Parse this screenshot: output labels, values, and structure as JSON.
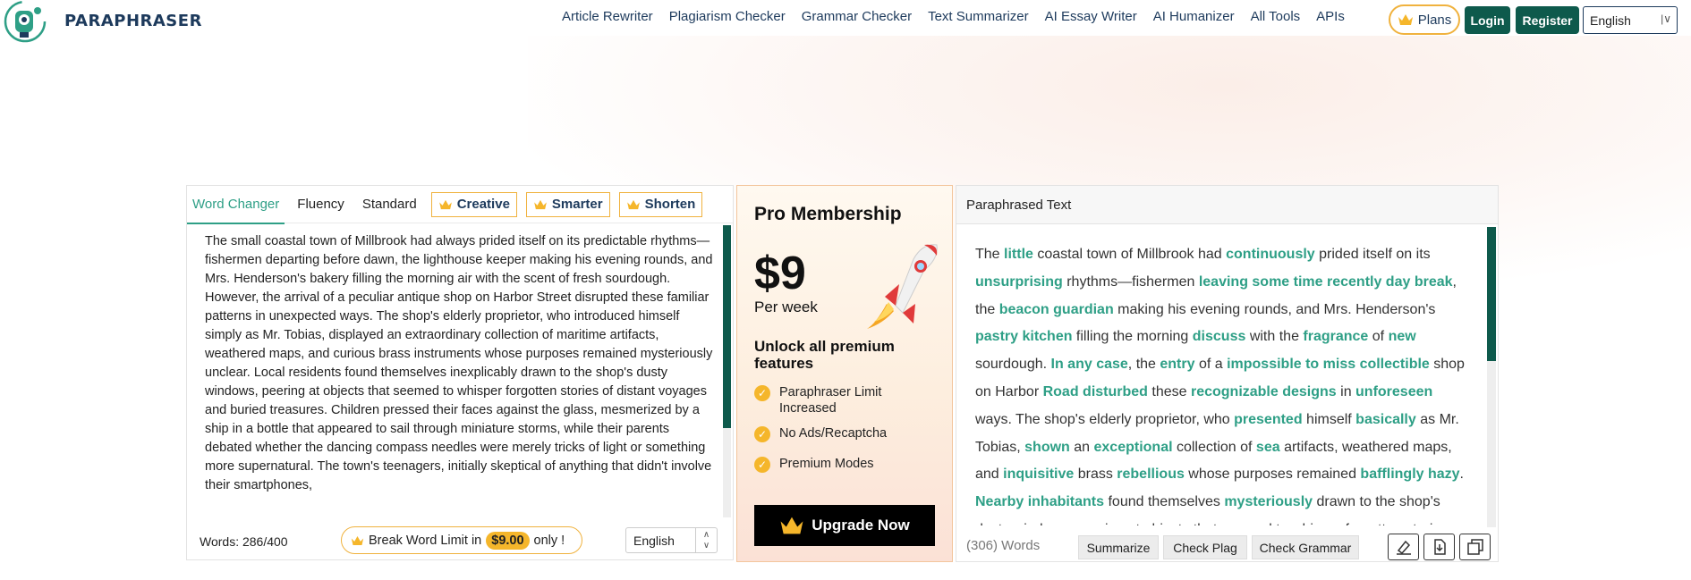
{
  "header": {
    "brand": "PARAPHRASER",
    "nav": [
      "Article Rewriter",
      "Plagiarism Checker",
      "Grammar Checker",
      "Text Summarizer",
      "AI Essay Writer",
      "AI Humanizer",
      "All Tools",
      "APIs"
    ],
    "plans_label": "Plans",
    "login_label": "Login",
    "register_label": "Register",
    "language": "English"
  },
  "editor": {
    "tabs": [
      "Word Changer",
      "Fluency",
      "Standard"
    ],
    "premium_tabs": [
      "Creative",
      "Smarter",
      "Shorten"
    ],
    "active_tab": "Word Changer",
    "input_text": "The small coastal town of Millbrook had always prided itself on its predictable rhythms—fishermen departing before dawn, the lighthouse keeper making his evening rounds, and Mrs. Henderson's bakery filling the morning air with the scent of fresh sourdough. However, the arrival of a peculiar antique shop on Harbor Street disrupted these familiar patterns in unexpected ways. The shop's elderly proprietor, who introduced himself simply as Mr. Tobias, displayed an extraordinary collection of maritime artifacts, weathered maps, and curious brass instruments whose purposes remained mysteriously unclear. Local residents found themselves inexplicably drawn to the shop's dusty windows, peering at objects that seemed to whisper forgotten stories of distant voyages and buried treasures. Children pressed their faces against the glass, mesmerized by a ship in a bottle that appeared to sail through miniature storms, while their parents debated whether the dancing compass needles were merely tricks of light or something more supernatural. The town's teenagers, initially skeptical of anything that didn't involve their smartphones,",
    "word_count": "Words: 286/400",
    "break_limit_prefix": "Break Word Limit in",
    "break_limit_price": "$9.00",
    "break_limit_suffix": "only !",
    "language": "English"
  },
  "pro": {
    "title": "Pro Membership",
    "price": "$9",
    "period": "Per week",
    "unlock": "Unlock all premium features",
    "features": [
      "Paraphraser Limit Increased",
      "No Ads/Recaptcha",
      "Premium Modes"
    ],
    "cta": "Upgrade Now"
  },
  "output": {
    "heading": "Paraphrased Text",
    "segments": [
      [
        "The ",
        0
      ],
      [
        "little",
        1
      ],
      [
        " coastal town of Millbrook had ",
        0
      ],
      [
        "continuously",
        1
      ],
      [
        " prided itself on its ",
        0
      ],
      [
        "unsurprising",
        1
      ],
      [
        " rhythms—fishermen ",
        0
      ],
      [
        "leaving some time recently day break",
        1
      ],
      [
        ", the ",
        0
      ],
      [
        "beacon guardian",
        1
      ],
      [
        " making his evening rounds, and Mrs. Henderson's ",
        0
      ],
      [
        "pastry kitchen",
        1
      ],
      [
        " filling the morning ",
        0
      ],
      [
        "discuss",
        1
      ],
      [
        " with the ",
        0
      ],
      [
        "fragrance",
        1
      ],
      [
        " of ",
        0
      ],
      [
        "new",
        1
      ],
      [
        " sourdough. ",
        0
      ],
      [
        "In any case",
        1
      ],
      [
        ", the ",
        0
      ],
      [
        "entry",
        1
      ],
      [
        " of a ",
        0
      ],
      [
        "impossible to miss collectible",
        1
      ],
      [
        " shop on Harbor ",
        0
      ],
      [
        "Road disturbed",
        1
      ],
      [
        " these ",
        0
      ],
      [
        "recognizable designs",
        1
      ],
      [
        " in ",
        0
      ],
      [
        "unforeseen",
        1
      ],
      [
        " ways. The shop's elderly proprietor, who ",
        0
      ],
      [
        "presented",
        1
      ],
      [
        " himself ",
        0
      ],
      [
        "basically",
        1
      ],
      [
        " as Mr. Tobias, ",
        0
      ],
      [
        "shown",
        1
      ],
      [
        " an ",
        0
      ],
      [
        "exceptional",
        1
      ],
      [
        " collection of ",
        0
      ],
      [
        "sea",
        1
      ],
      [
        " artifacts, weathered maps, and ",
        0
      ],
      [
        "inquisitive",
        1
      ],
      [
        " brass ",
        0
      ],
      [
        "rebellious",
        1
      ],
      [
        " whose purposes remained ",
        0
      ],
      [
        "bafflingly hazy",
        1
      ],
      [
        ". ",
        0
      ],
      [
        "Nearby inhabitants",
        1
      ],
      [
        " found themselves ",
        0
      ],
      [
        "mysteriously",
        1
      ],
      [
        " drawn to the shop's dusty windows, peering at objects that seemed to whisper forgotten stories.",
        0
      ]
    ],
    "word_count": "(306) Words",
    "actions": [
      "Summarize",
      "Check Plag",
      "Check Grammar"
    ]
  },
  "colors": {
    "brand_dark": "#1d3a5c",
    "accent_green": "#2e9f86",
    "button_green": "#0e5a4c",
    "gold": "#f5b62b"
  }
}
